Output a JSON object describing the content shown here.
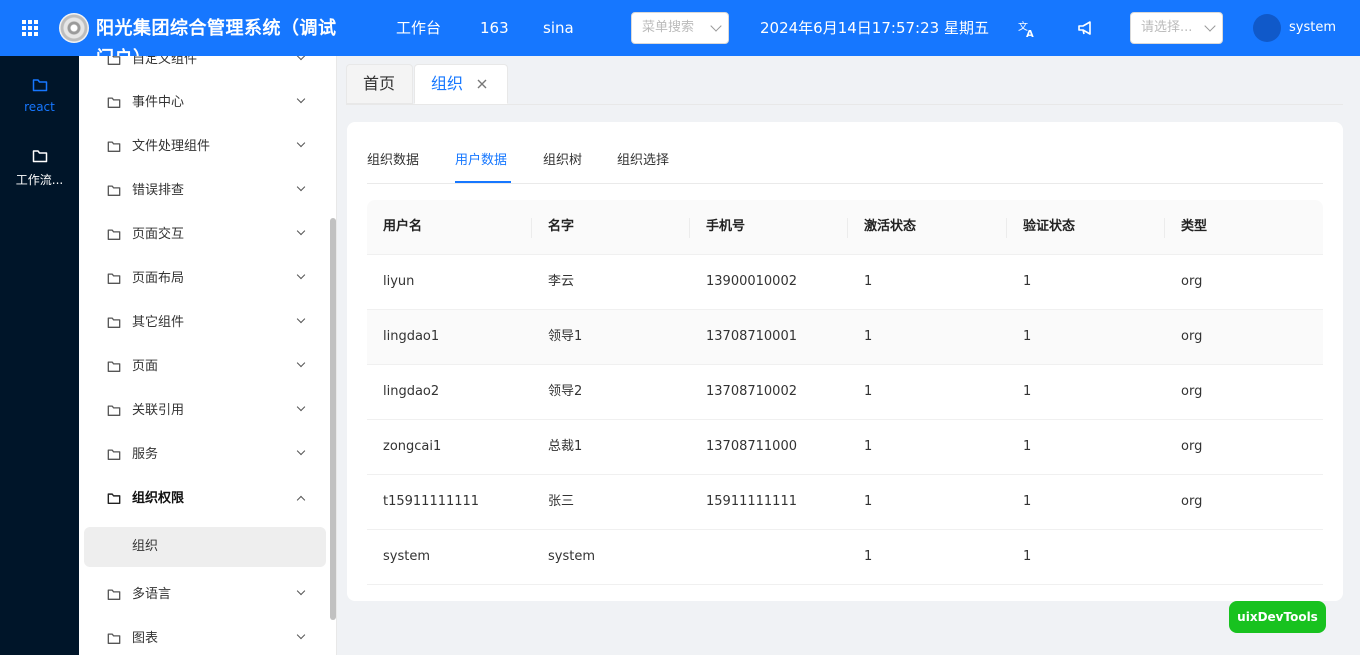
{
  "header": {
    "brand": "阳光集团综合管理系统（调试门户）",
    "nav": [
      "工作台",
      "163",
      "sina"
    ],
    "menu_search_placeholder": "菜单搜索",
    "datetime": "2024年6月14日17:57:23 星期五",
    "lang_select_placeholder": "请选择...",
    "user": "system",
    "icons": [
      "apps-grid-icon",
      "translate-icon",
      "megaphone-icon"
    ]
  },
  "rail": {
    "items": [
      {
        "label": "react",
        "icon": "folder-icon",
        "active": true
      },
      {
        "label": "工作流...",
        "icon": "folder-icon",
        "active": false
      }
    ]
  },
  "submenu": {
    "items": [
      {
        "label": "自定义组件"
      },
      {
        "label": "事件中心"
      },
      {
        "label": "文件处理组件"
      },
      {
        "label": "错误排查"
      },
      {
        "label": "页面交互"
      },
      {
        "label": "页面布局"
      },
      {
        "label": "其它组件"
      },
      {
        "label": "页面"
      },
      {
        "label": "关联引用"
      },
      {
        "label": "服务"
      },
      {
        "label": "组织权限",
        "expanded": true
      },
      {
        "label": "组织",
        "selected": true
      },
      {
        "label": "多语言"
      },
      {
        "label": "图表"
      }
    ]
  },
  "page_tabs": [
    {
      "label": "首页",
      "active": false
    },
    {
      "label": "组织",
      "active": true,
      "closable": true
    }
  ],
  "subtabs": [
    {
      "label": "组织数据",
      "active": false
    },
    {
      "label": "用户数据",
      "active": true
    },
    {
      "label": "组织树",
      "active": false
    },
    {
      "label": "组织选择",
      "active": false
    }
  ],
  "table": {
    "columns": [
      "用户名",
      "名字",
      "手机号",
      "激活状态",
      "验证状态",
      "类型"
    ],
    "rows": [
      [
        "liyun",
        "李云",
        "13900010002",
        "1",
        "1",
        "org"
      ],
      [
        "lingdao1",
        "领导1",
        "13708710001",
        "1",
        "1",
        "org"
      ],
      [
        "lingdao2",
        "领导2",
        "13708710002",
        "1",
        "1",
        "org"
      ],
      [
        "zongcai1",
        "总裁1",
        "13708711000",
        "1",
        "1",
        "org"
      ],
      [
        "t15911111111",
        "张三",
        "15911111111",
        "1",
        "1",
        "org"
      ],
      [
        "system",
        "system",
        "",
        "1",
        "1",
        ""
      ]
    ]
  },
  "dev_button": "uixDevTools",
  "colors": {
    "primary": "#1677ff",
    "sidebar": "#001529",
    "dev_button": "#18c21f"
  }
}
